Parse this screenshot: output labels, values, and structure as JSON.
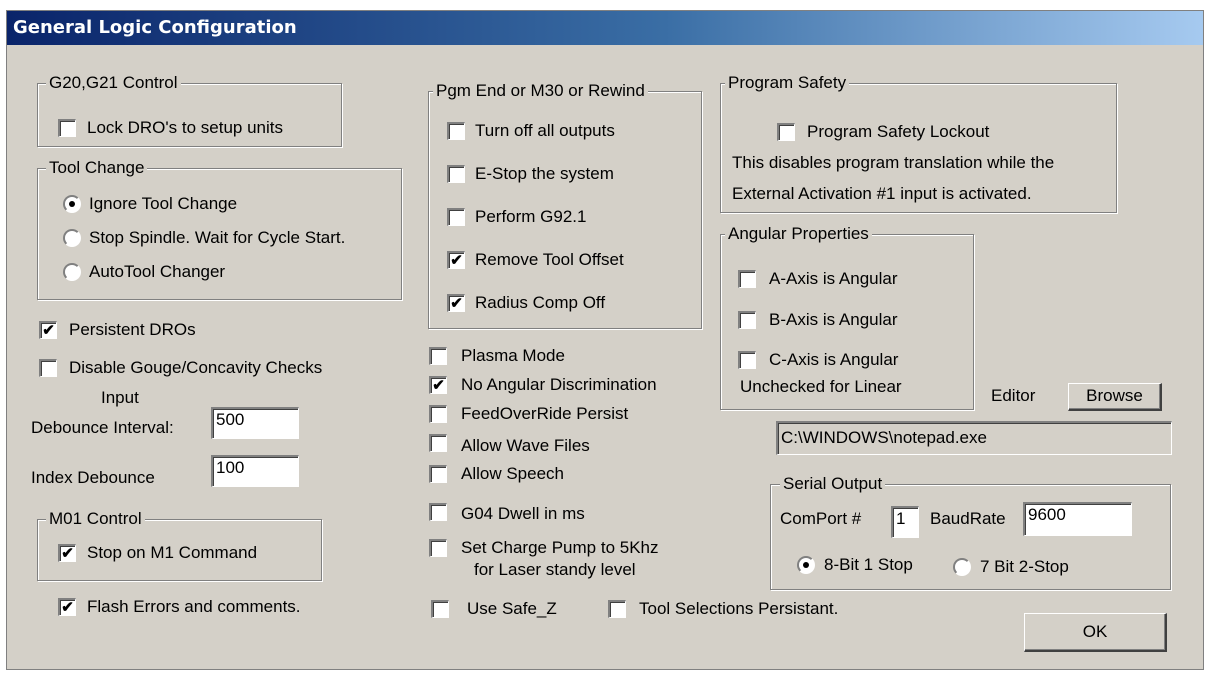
{
  "title": "General Logic Configuration",
  "g20": {
    "legend": "G20,G21 Control",
    "lock_label": "Lock DRO's to setup units",
    "lock_checked": false
  },
  "tool_change": {
    "legend": "Tool Change",
    "options": [
      "Ignore Tool Change",
      "Stop Spindle. Wait for Cycle Start.",
      "AutoTool Changer"
    ],
    "selected": 0
  },
  "persistent_dros": {
    "label": "Persistent DROs",
    "checked": true
  },
  "disable_gouge": {
    "label": "Disable Gouge/Concavity Checks",
    "checked": false
  },
  "input_debounce": {
    "label_line1": "Input",
    "label_line2": "Debounce Interval:",
    "value": "500"
  },
  "index_debounce": {
    "label": "Index Debounce",
    "value": "100"
  },
  "m01": {
    "legend": "M01 Control",
    "label": "Stop on M1 Command",
    "checked": true
  },
  "flash_errors": {
    "label": "Flash Errors and comments.",
    "checked": true
  },
  "pgm_end": {
    "legend": "Pgm End or M30 or Rewind",
    "items": [
      {
        "label": "Turn off all outputs",
        "checked": false
      },
      {
        "label": "E-Stop the system",
        "checked": false
      },
      {
        "label": "Perform G92.1",
        "checked": false
      },
      {
        "label": "Remove Tool Offset",
        "checked": true
      },
      {
        "label": "Radius Comp Off",
        "checked": true
      }
    ]
  },
  "options": {
    "plasma_mode": {
      "label": "Plasma Mode",
      "checked": false
    },
    "no_angular": {
      "label": "No Angular Discrimination",
      "checked": true
    },
    "feed_override": {
      "label": "FeedOverRide Persist",
      "checked": false
    },
    "wave_files": {
      "label": "Allow Wave Files",
      "checked": false
    },
    "speech": {
      "label": "Allow Speech",
      "checked": false
    },
    "g04": {
      "label": "G04 Dwell in ms",
      "checked": false
    },
    "charge_pump": {
      "label_line1": "Set Charge Pump to 5Khz",
      "label_line2": "for Laser standy level",
      "checked": false
    },
    "safe_z": {
      "label": "Use Safe_Z",
      "checked": false
    },
    "tool_selections": {
      "label": "Tool Selections Persistant.",
      "checked": false
    }
  },
  "program_safety": {
    "legend": "Program Safety",
    "lockout_label": "Program Safety Lockout",
    "lockout_checked": false,
    "desc_line1": "This disables program translation while the",
    "desc_line2": "External Activation #1 input is activated."
  },
  "angular": {
    "legend": "Angular Properties",
    "items": [
      {
        "label": "A-Axis is Angular",
        "checked": false
      },
      {
        "label": "B-Axis is Angular",
        "checked": false
      },
      {
        "label": "C-Axis is Angular",
        "checked": false
      }
    ],
    "note": "Unchecked for Linear"
  },
  "editor": {
    "label": "Editor",
    "browse": "Browse",
    "path": "C:\\WINDOWS\\notepad.exe"
  },
  "serial": {
    "legend": "Serial Output",
    "comport_label": "ComPort #",
    "comport_value": "1",
    "baud_label": "BaudRate",
    "baud_value": "9600",
    "options": [
      "8-Bit 1 Stop",
      "7 Bit 2-Stop"
    ],
    "selected": 0
  },
  "ok": "OK"
}
